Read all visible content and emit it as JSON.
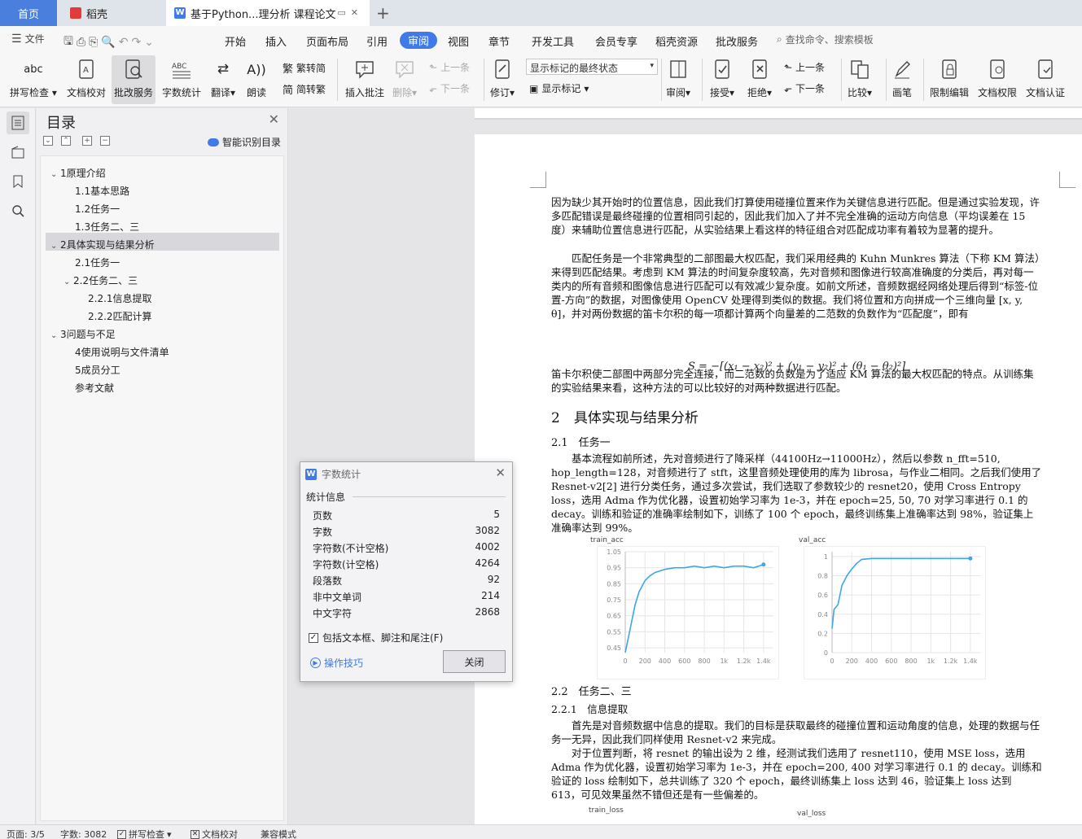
{
  "tabs": {
    "home": "首页",
    "daoke": "稻壳",
    "document": "基于Python...理分析 课程论文"
  },
  "menu": {
    "file": "文件",
    "items": [
      "开始",
      "插入",
      "页面布局",
      "引用",
      "审阅",
      "视图",
      "章节",
      "开发工具",
      "会员专享",
      "稻壳资源",
      "批改服务"
    ],
    "search_placeholder": "查找命令、搜索模板"
  },
  "ribbon": {
    "spell_check": "拼写检查",
    "doc_proof": "文档校对",
    "review_service": "批改服务",
    "word_count": "字数统计",
    "translate": "翻译",
    "read_aloud": "朗读",
    "trad_to_simp": "繁转简",
    "simp_to_trad": "简转繁",
    "insert_comment": "插入批注",
    "delete": "删除",
    "prev_comment": "上一条",
    "next_comment": "下一条",
    "track_changes": "修订",
    "markup_mode": "显示标记的最终状态",
    "show_markup": "显示标记",
    "review_pane": "审阅",
    "accept": "接受",
    "reject": "拒绝",
    "prev_change": "上一条",
    "next_change": "下一条",
    "compare": "比较",
    "pen": "画笔",
    "restrict_edit": "限制编辑",
    "doc_permission": "文档权限",
    "doc_certify": "文档认证"
  },
  "nav": {
    "title": "目录",
    "smart_toc": "智能识别目录",
    "items": [
      {
        "label": "1原理介绍",
        "level": 1,
        "expanded": true
      },
      {
        "label": "1.1基本思路",
        "level": 2
      },
      {
        "label": "1.2任务一",
        "level": 2
      },
      {
        "label": "1.3任务二、三",
        "level": 2
      },
      {
        "label": "2具体实现与结果分析",
        "level": 1,
        "expanded": true,
        "selected": true
      },
      {
        "label": "2.1任务一",
        "level": 2
      },
      {
        "label": "2.2任务二、三",
        "level": 2,
        "expanded": true
      },
      {
        "label": "2.2.1信息提取",
        "level": 3
      },
      {
        "label": "2.2.2匹配计算",
        "level": 3
      },
      {
        "label": "3问题与不足",
        "level": 1,
        "expanded": true
      },
      {
        "label": "4使用说明与文件清单",
        "level": 2
      },
      {
        "label": "5成员分工",
        "level": 2
      },
      {
        "label": "参考文献",
        "level": 2
      }
    ]
  },
  "document": {
    "para1": "因为缺少其开始时的位置信息，因此我们打算使用碰撞位置来作为关键信息进行匹配。但是通过实验发现，许多匹配错误是最终碰撞的位置相同引起的，因此我们加入了并不完全准确的运动方向信息（平均误差在 15 度）来辅助位置信息进行匹配，从实验结果上看这样的特征组合对匹配成功率有着较为显著的提升。",
    "para2": "匹配任务是一个非常典型的二部图最大权匹配，我们采用经典的 Kuhn Munkres 算法（下称 KM 算法）来得到匹配结果。考虑到 KM 算法的时间复杂度较高，先对音频和图像进行较高准确度的分类后，再对每一类内的所有音频和图像信息进行匹配可以有效减少复杂度。如前文所述，音频数据经网络处理后得到“标签-位置-方向”的数据，对图像使用 OpenCV 处理得到类似的数据。我们将位置和方向拼成一个三维向量 [x, y, θ]，并对两份数据的笛卡尔积的每一项都计算两个向量差的二范数的负数作为“匹配度”，即有",
    "formula": "S = −[(x₁ − x₂)² + (y₁ − y₂)² + (θ₁ − θ₂)²]",
    "para3": "笛卡尔积使二部图中两部分完全连接，而二范数的负数是为了适应 KM 算法的最大权匹配的特点。从训练集的实验结果来看，这种方法的可以比较好的对两种数据进行匹配。",
    "h2": "2　具体实现与结果分析",
    "h3_1": "2.1　任务一",
    "para4": "基本流程如前所述，先对音频进行了降采样（44100Hz→11000Hz），然后以参数 n_fft=510, hop_length=128，对音频进行了 stft，这里音频处理使用的库为 librosa，与作业二相同。之后我们使用了 Resnet-v2[2] 进行分类任务，通过多次尝试，我们选取了参数较少的 resnet20，使用 Cross Entropy loss，选用 Adma 作为优化器，设置初始学习率为 1e-3，并在 epoch=25, 50, 70 对学习率进行 0.1 的 decay。训练和验证的准确率绘制如下，训练了 100 个 epoch，最终训练集上准确率达到 98%，验证集上准确率达到 99%。",
    "chart1_title": "train_acc",
    "chart2_title": "val_acc",
    "h3_2": "2.2　任务二、三",
    "h4_1": "2.2.1　信息提取",
    "para5": "首先是对音频数据中信息的提取。我们的目标是获取最终的碰撞位置和运动角度的信息，处理的数据与任务一无异，因此我们同样使用 Resnet-v2 来完成。",
    "para6": "对于位置判断，将 resnet 的输出设为 2 维，经测试我们选用了 resnet110，使用 MSE loss，选用 Adma 作为优化器，设置初始学习率为 1e-3，并在 epoch=200, 400 对学习率进行 0.1 的 decay。训练和验证的 loss 绘制如下，总共训练了 320 个 epoch，最终训练集上 loss 达到 46，验证集上 loss 达到 613，可见效果虽然不错但还是有一些偏差的。",
    "chart3_title": "train_loss",
    "chart4_title": "val_loss"
  },
  "dialog": {
    "title": "字数统计",
    "section": "统计信息",
    "stats": [
      {
        "label": "页数",
        "value": "5"
      },
      {
        "label": "字数",
        "value": "3082"
      },
      {
        "label": "字符数(不计空格)",
        "value": "4002"
      },
      {
        "label": "字符数(计空格)",
        "value": "4264"
      },
      {
        "label": "段落数",
        "value": "92"
      },
      {
        "label": "非中文单词",
        "value": "214"
      },
      {
        "label": "中文字符",
        "value": "2868"
      }
    ],
    "include_label": "包括文本框、脚注和尾注(F)",
    "include_checked": true,
    "tips": "操作技巧",
    "close": "关闭"
  },
  "status": {
    "page": "页面: 3/5",
    "words": "字数: 3082",
    "spell": "拼写检查",
    "proof": "文档校对",
    "compat": "兼容模式"
  },
  "colors": {
    "accent": "#3f7ae8",
    "chart_line": "#3ea6e6"
  },
  "chart_data": [
    {
      "type": "line",
      "title": "train_acc",
      "x_ticks": [
        "0",
        "200",
        "400",
        "600",
        "800",
        "1k",
        "1.2k",
        "1.4k"
      ],
      "y_ticks": [
        "0.45",
        "0.55",
        "0.65",
        "0.75",
        "0.85",
        "0.95",
        "1.05"
      ],
      "ylim": [
        0.42,
        1.05
      ],
      "series": [
        {
          "x": [
            0,
            60,
            100,
            140,
            200,
            250,
            300,
            400,
            500,
            600,
            700,
            800,
            900,
            1000,
            1100,
            1200,
            1300,
            1400
          ],
          "values": [
            0.42,
            0.6,
            0.72,
            0.8,
            0.87,
            0.9,
            0.92,
            0.94,
            0.95,
            0.95,
            0.96,
            0.95,
            0.96,
            0.95,
            0.96,
            0.96,
            0.95,
            0.97
          ]
        }
      ]
    },
    {
      "type": "line",
      "title": "val_acc",
      "x_ticks": [
        "0",
        "200",
        "400",
        "600",
        "800",
        "1k",
        "1.2k",
        "1.4k"
      ],
      "y_ticks": [
        "0",
        "0.2",
        "0.4",
        "0.6",
        "0.8",
        "1"
      ],
      "ylim": [
        0,
        1.05
      ],
      "series": [
        {
          "x": [
            0,
            20,
            60,
            100,
            150,
            200,
            250,
            300,
            400,
            500,
            600,
            800,
            1000,
            1200,
            1400
          ],
          "values": [
            0.25,
            0.45,
            0.5,
            0.7,
            0.8,
            0.87,
            0.93,
            0.97,
            0.98,
            0.98,
            0.98,
            0.98,
            0.98,
            0.98,
            0.98
          ]
        }
      ]
    }
  ]
}
